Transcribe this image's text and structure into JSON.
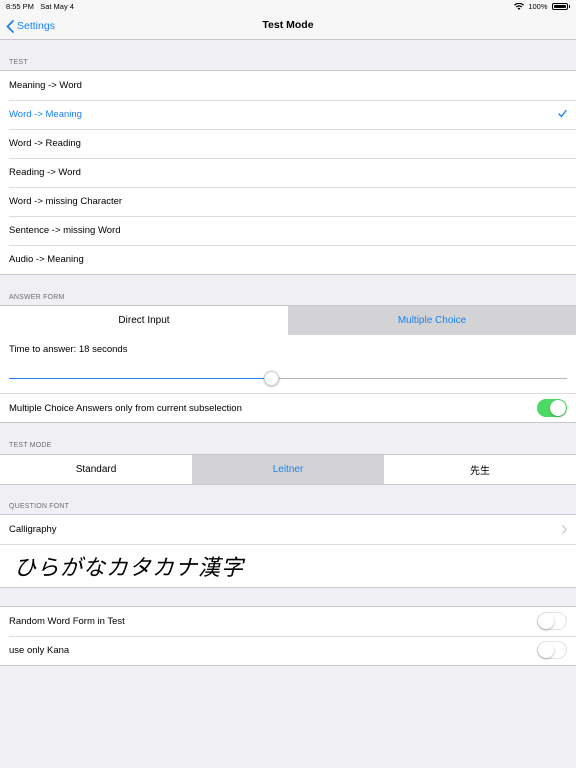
{
  "status_bar": {
    "time": "8:55 PM",
    "date": "Sat May 4",
    "battery": "100%"
  },
  "nav": {
    "back_label": "Settings",
    "title": "Test Mode"
  },
  "test_section": {
    "header": "TEST",
    "items": [
      {
        "label": "Meaning -> Word"
      },
      {
        "label": "Word -> Meaning"
      },
      {
        "label": "Word -> Reading"
      },
      {
        "label": "Reading -> Word"
      },
      {
        "label": "Word -> missing Character"
      },
      {
        "label": "Sentence -> missing Word"
      },
      {
        "label": "Audio -> Meaning"
      }
    ],
    "selected_item": "Word -> Meaning"
  },
  "answer_form": {
    "header": "ANSWER FORM",
    "options": [
      "Direct Input",
      "Multiple Choice"
    ],
    "selected": "Multiple Choice",
    "time_label": "Time to answer: 18 seconds",
    "slider_fraction": 0.47,
    "subselection_label": "Multiple Choice Answers only from current subselection",
    "subselection_on": true
  },
  "test_mode": {
    "header": "TEST MODE",
    "options": [
      "Standard",
      "Leitner",
      "先生"
    ],
    "selected": "Leitner"
  },
  "question_font": {
    "header": "QUESTION FONT",
    "font_name": "Calligraphy",
    "preview_text": "ひらがなカタカナ漢字"
  },
  "misc": {
    "random_word_form_label": "Random Word Form in Test",
    "random_word_form_on": false,
    "only_kana_label": "use only Kana",
    "only_kana_on": false
  },
  "colors": {
    "accent": "#1a82f0",
    "toggle_on": "#4cd964",
    "background": "#efeff4"
  }
}
